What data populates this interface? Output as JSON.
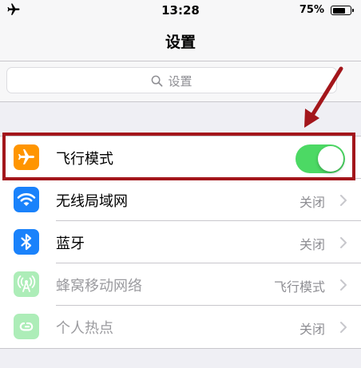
{
  "status_bar": {
    "time": "13:28",
    "battery_text": "75%",
    "battery_level": 0.75
  },
  "nav": {
    "title": "设置"
  },
  "search": {
    "placeholder": "设置"
  },
  "rows": [
    {
      "label": "飞行模式",
      "icon": "airplane-icon",
      "icon_color": "#ff9500",
      "toggle_on": true
    },
    {
      "label": "无线局域网",
      "icon": "wifi-icon",
      "icon_color": "#1a82fb",
      "value": "关闭"
    },
    {
      "label": "蓝牙",
      "icon": "bluetooth-icon",
      "icon_color": "#1a82fb",
      "value": "关闭"
    },
    {
      "label": "蜂窝移动网络",
      "icon": "cellular-icon",
      "icon_color": "#4cd964",
      "value": "飞行模式",
      "disabled": true
    },
    {
      "label": "个人热点",
      "icon": "hotspot-icon",
      "icon_color": "#4cd964",
      "value": "关闭",
      "disabled": true
    }
  ],
  "colors": {
    "toggle_on": "#4cd964",
    "highlight": "#a3161b"
  }
}
